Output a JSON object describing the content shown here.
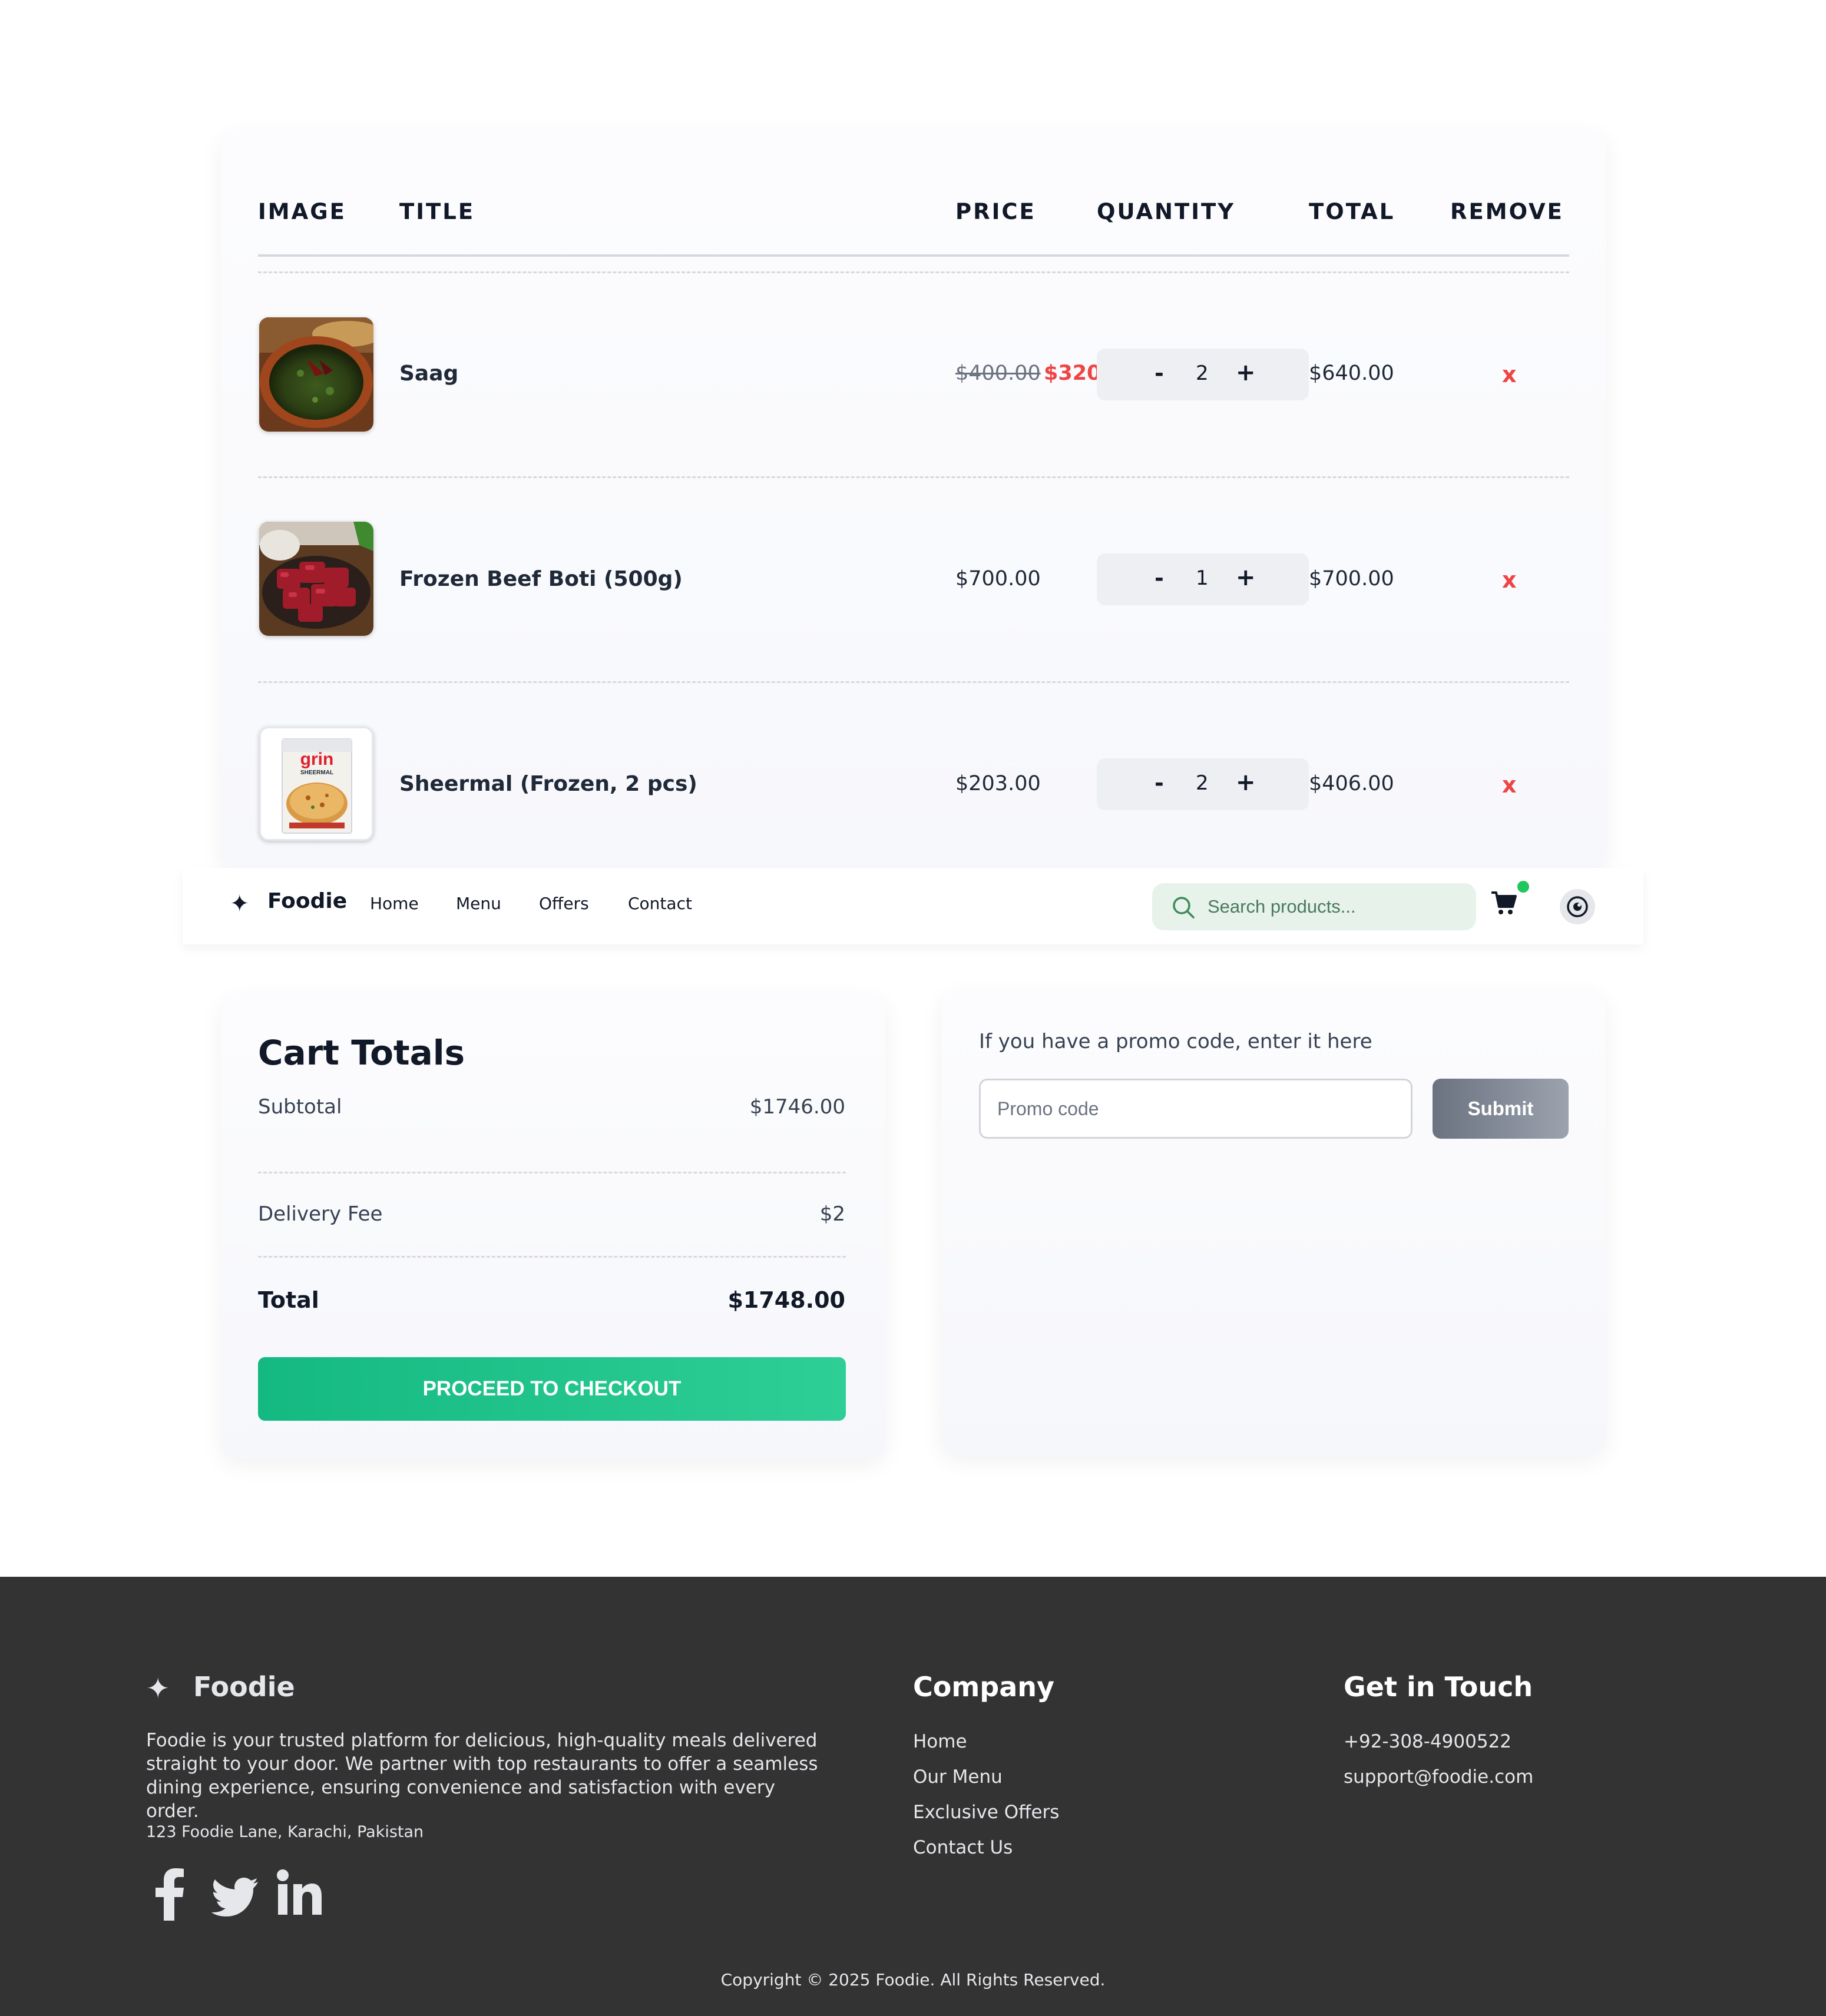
{
  "cart": {
    "headers": {
      "image": "IMAGE",
      "title": "TITLE",
      "price": "PRICE",
      "quantity": "QUANTITY",
      "total": "TOTAL",
      "remove": "REMOVE"
    },
    "items": [
      {
        "title": "Saag",
        "old_price": "$400.00",
        "price": "$320.",
        "qty_minus": "-",
        "quantity": "2",
        "qty_plus": "+",
        "total": "$640.00",
        "remove": "x"
      },
      {
        "title": "Frozen Beef Boti (500g)",
        "price": "$700.00",
        "qty_minus": "-",
        "quantity": "1",
        "qty_plus": "+",
        "total": "$700.00",
        "remove": "x"
      },
      {
        "title": "Sheermal (Frozen, 2 pcs)",
        "price": "$203.00",
        "qty_minus": "-",
        "quantity": "2",
        "qty_plus": "+",
        "total": "$406.00",
        "remove": "x",
        "package_brand": "grin",
        "package_label": "SHEERMAL"
      }
    ]
  },
  "navbar": {
    "logo": "Foodie",
    "links": [
      "Home",
      "Menu",
      "Offers",
      "Contact"
    ],
    "search_placeholder": "Search products...",
    "cart_badge_color": "#22c55e"
  },
  "totals": {
    "title": "Cart Totals",
    "subtotal_label": "Subtotal",
    "subtotal_value": "$1746.00",
    "delivery_label": "Delivery Fee",
    "delivery_value": "$2",
    "total_label": "Total",
    "total_value": "$1748.00",
    "checkout_label": "PROCEED TO CHECKOUT"
  },
  "promo": {
    "label": "If you have a promo code, enter it here",
    "placeholder": "Promo code",
    "submit_label": "Submit"
  },
  "footer": {
    "logo": "Foodie",
    "description": "Foodie is your trusted platform for delicious, high-quality meals delivered straight to your door. We partner with top restaurants to offer a seamless dining experience, ensuring convenience and satisfaction with every order.",
    "address": "123 Foodie Lane, Karachi, Pakistan",
    "social_icons": [
      "facebook-icon",
      "twitter-icon",
      "linkedin-icon"
    ],
    "company": {
      "heading": "Company",
      "links": [
        "Home",
        "Our Menu",
        "Exclusive Offers",
        "Contact Us"
      ]
    },
    "contact": {
      "heading": "Get in Touch",
      "phone": "+92-308-4900522",
      "email": "support@foodie.com"
    },
    "copyright": "Copyright © 2025 Foodie. All Rights Reserved."
  },
  "colors": {
    "accent_green": "#14b981",
    "sale_red": "#ef4444",
    "footer_bg": "#333333"
  }
}
